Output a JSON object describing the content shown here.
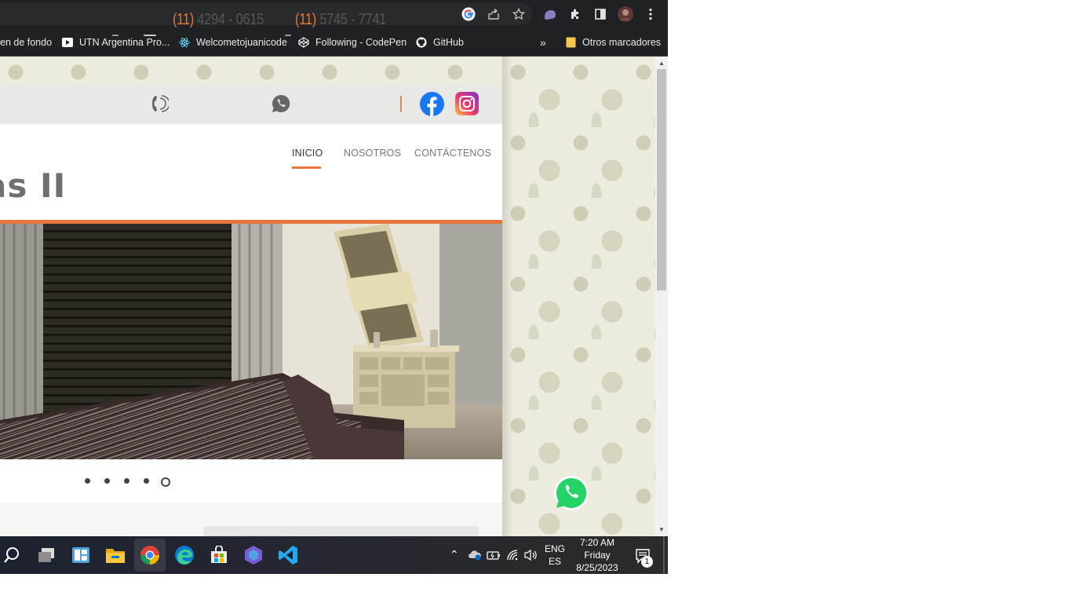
{
  "browser": {
    "bookmarks": [
      {
        "label": "en de fondo",
        "icon": "folder-icon"
      },
      {
        "label": "UTN Argentina Pro...",
        "icon": "play-icon"
      },
      {
        "label": "Welcometojuanicode",
        "icon": "react-icon"
      },
      {
        "label": "Following - CodePen",
        "icon": "codepen-icon"
      },
      {
        "label": "GitHub",
        "icon": "github-icon"
      }
    ],
    "overflow_label": "»",
    "other_bookmarks": "Otros marcadores"
  },
  "site": {
    "phones": [
      {
        "area": "(11)",
        "number": "4294 - 0615",
        "icon": "phone-icon"
      },
      {
        "area": "(11)",
        "number": "5745 - 7741",
        "icon": "whatsapp-icon"
      }
    ],
    "separator": "|",
    "logo_partial": "as II",
    "nav": [
      {
        "label": "INICIO",
        "active": true
      },
      {
        "label": "NOSOTROS",
        "active": false
      },
      {
        "label": "CONTÁCTENOS",
        "active": false
      }
    ],
    "slider": {
      "count": 5,
      "active_index": 4
    },
    "accent_color": "#e8763a"
  },
  "taskbar": {
    "language_top": "ENG",
    "language_bottom": "ES",
    "time": "7:20 AM",
    "day": "Friday",
    "date": "8/25/2023",
    "notification_count": "1"
  }
}
